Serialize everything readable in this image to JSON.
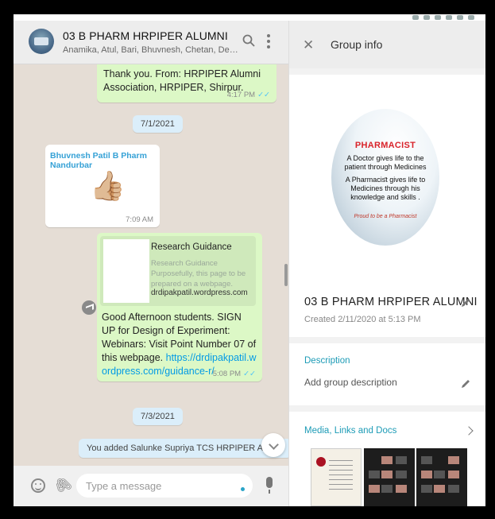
{
  "chat": {
    "title": "03 B PHARM HRPIPER ALUMNI",
    "members": "Anamika, Atul, Bari, Bhuvnesh, Chetan, Devendra, Dha...",
    "messages": {
      "m1": {
        "text": "Thank you. From: HRPIPER Alumni Association, HRPIPER, Shirpur.",
        "time": "4:17 PM",
        "ticks": "✓✓"
      },
      "date1": "7/1/2021",
      "m2": {
        "sender": "Bhuvnesh Patil B Pharm Nandurbar",
        "emoji": "👍🏼",
        "time": "7:09 AM"
      },
      "m3": {
        "preview_title": "Research Guidance",
        "preview_desc": "Research Guidance Purposefully, this page to be prepared on a webpage.",
        "preview_domain": "drdipakpatil.wordpress.com",
        "text": "Good Afternoon students. SIGN UP for Design of Experiment: Webinars: Visit Point Number 07 of this webpage.",
        "link": "https://drdipakpatil.wordpress.com/guidance-r/",
        "time": "5:08 PM",
        "ticks": "✓✓"
      },
      "date2": "7/3/2021",
      "system": "You added Salunke Supriya TCS HRPIPER Alumni"
    },
    "composer": {
      "placeholder": "Type a message",
      "attach_glyph": "🖇"
    }
  },
  "info": {
    "close_glyph": "✕",
    "title": "Group info",
    "photo": {
      "heading": "PHARMACIST",
      "line1": "A Doctor gives life to the patient through Medicines .",
      "line2": "A Pharmacist gives life to Medicines through his knowledge and skills .",
      "line3": "Proud to be a Pharmacist"
    },
    "group_name": "03 B PHARM HRPIPER ALUMNI",
    "created": "Created 2/11/2020 at 5:13 PM",
    "description_label": "Description",
    "description_placeholder": "Add group description",
    "media_label": "Media, Links and Docs"
  },
  "colors": {
    "outgoing_bubble": "#dcf8c6",
    "incoming_bubble": "#ffffff",
    "accent": "#1c9bb6",
    "read_ticks": "#4fc3f7"
  }
}
